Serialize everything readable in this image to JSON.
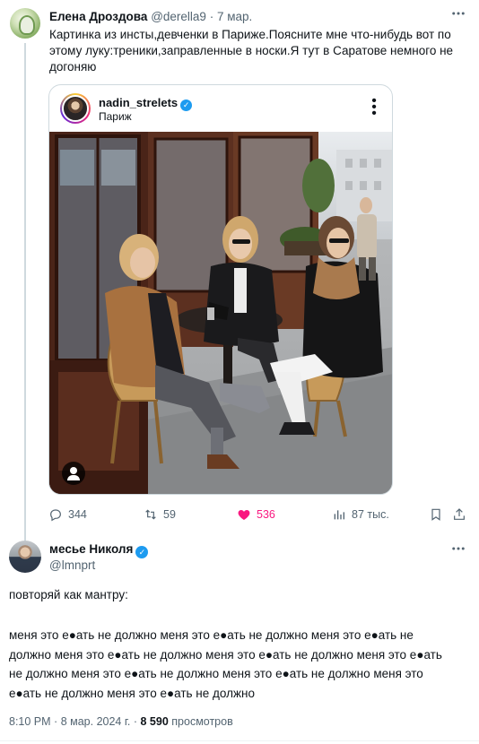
{
  "tweet1": {
    "author_name": "Елена Дроздова",
    "author_handle": "@derella9",
    "separator": "·",
    "date": "7 мар.",
    "text": "Картинка из инсты,девченки в Париже.Поясните мне что-нибудь вот по этому луку:треники,заправленные в носки.Я тут в Саратове немного не догоняю",
    "embed": {
      "username": "nadin_strelets",
      "location": "Париж"
    },
    "stats": {
      "replies": "344",
      "retweets": "59",
      "likes": "536",
      "views": "87 тыс."
    }
  },
  "tweet2": {
    "author_name": "месье Николя",
    "author_handle": "@lmnprt",
    "line1": "повторяй как мантру:",
    "body": "меня это е●ать не должно меня это е●ать не должно меня это е●ать не должно меня это е●ать не должно меня это е●ать не должно меня это е●ать не должно меня это е●ать не должно меня это е●ать не должно меня это е●ать не должно меня это е●ать не должно",
    "time": "8:10 PM",
    "date": "8 мар. 2024 г.",
    "views_count": "8 590",
    "views_label": "просмотров"
  },
  "colors": {
    "like_pink": "#f91880",
    "verified_blue": "#1d9bf0",
    "secondary_text": "#536471"
  },
  "icons": [
    "more-icon",
    "verified-icon",
    "reply-icon",
    "retweet-icon",
    "like-icon",
    "views-icon",
    "bookmark-icon",
    "share-icon",
    "tag-people-icon"
  ]
}
